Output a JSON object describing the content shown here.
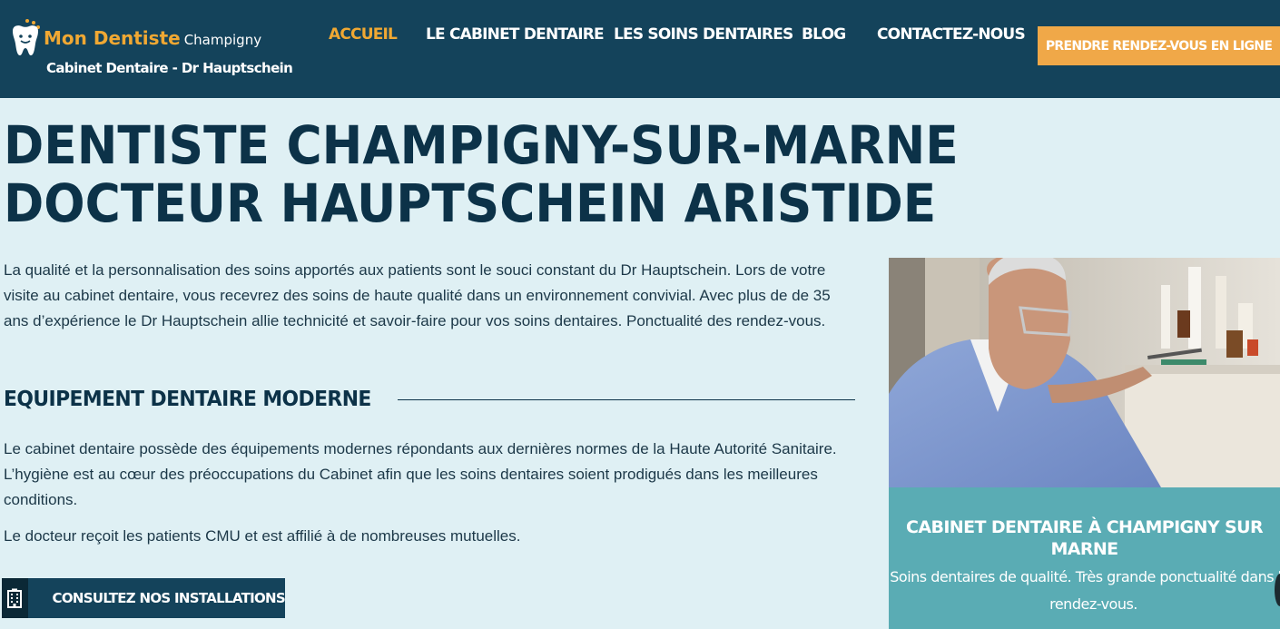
{
  "header": {
    "logo": {
      "brand": "Mon Dentiste",
      "city": "Champigny",
      "subtitle": "Cabinet Dentaire - Dr Hauptschein",
      "icon": "tooth-icon"
    },
    "nav": [
      {
        "label": "ACCUEIL",
        "active": true
      },
      {
        "label": "LE CABINET DENTAIRE",
        "active": false
      },
      {
        "label": "LES SOINS DENTAIRES",
        "active": false
      },
      {
        "label": "BLOG",
        "active": false
      },
      {
        "label": "CONTACTEZ-NOUS",
        "active": false
      }
    ],
    "cta_label": "PRENDRE RENDEZ-VOUS EN LIGNE"
  },
  "main": {
    "title_line1": "DENTISTE CHAMPIGNY-SUR-MARNE",
    "title_line2": "DOCTEUR HAUPTSCHEIN ARISTIDE",
    "intro": "La qualité et la personnalisation des soins apportés aux patients sont le souci constant du Dr Hauptschein. Lors de votre visite au cabinet dentaire, vous recevrez des soins de haute qualité dans un environnement convivial. Avec plus de de 35 ans d’expérience le Dr Hauptschein allie technicité et savoir-faire pour vos soins dentaires. Ponctualité des rendez-vous.",
    "section_title": "EQUIPEMENT DENTAIRE MODERNE",
    "section_para1": "Le cabinet dentaire possède des équipements modernes répondants aux dernières normes de la Haute Autorité Sanitaire. L’hygiène est au cœur des préoccupations du Cabinet afin que les soins dentaires soient prodigués dans les meilleures conditions.",
    "section_para2": "Le docteur reçoit les patients CMU et est affilié à de nombreuses mutuelles.",
    "install_button": {
      "label": "CONSULTEZ NOS INSTALLATIONS",
      "icon": "building-icon"
    }
  },
  "card": {
    "title": "CABINET DENTAIRE À CHAMPIGNY SUR MARNE",
    "description": "Soins dentaires de qualité. Très grande ponctualité dans les rendez-vous."
  },
  "colors": {
    "header_bg": "#14435b",
    "accent": "#f0a833",
    "page_bg": "#dff0f4",
    "card_bg": "#5aacb4",
    "heading": "#0c3248"
  }
}
